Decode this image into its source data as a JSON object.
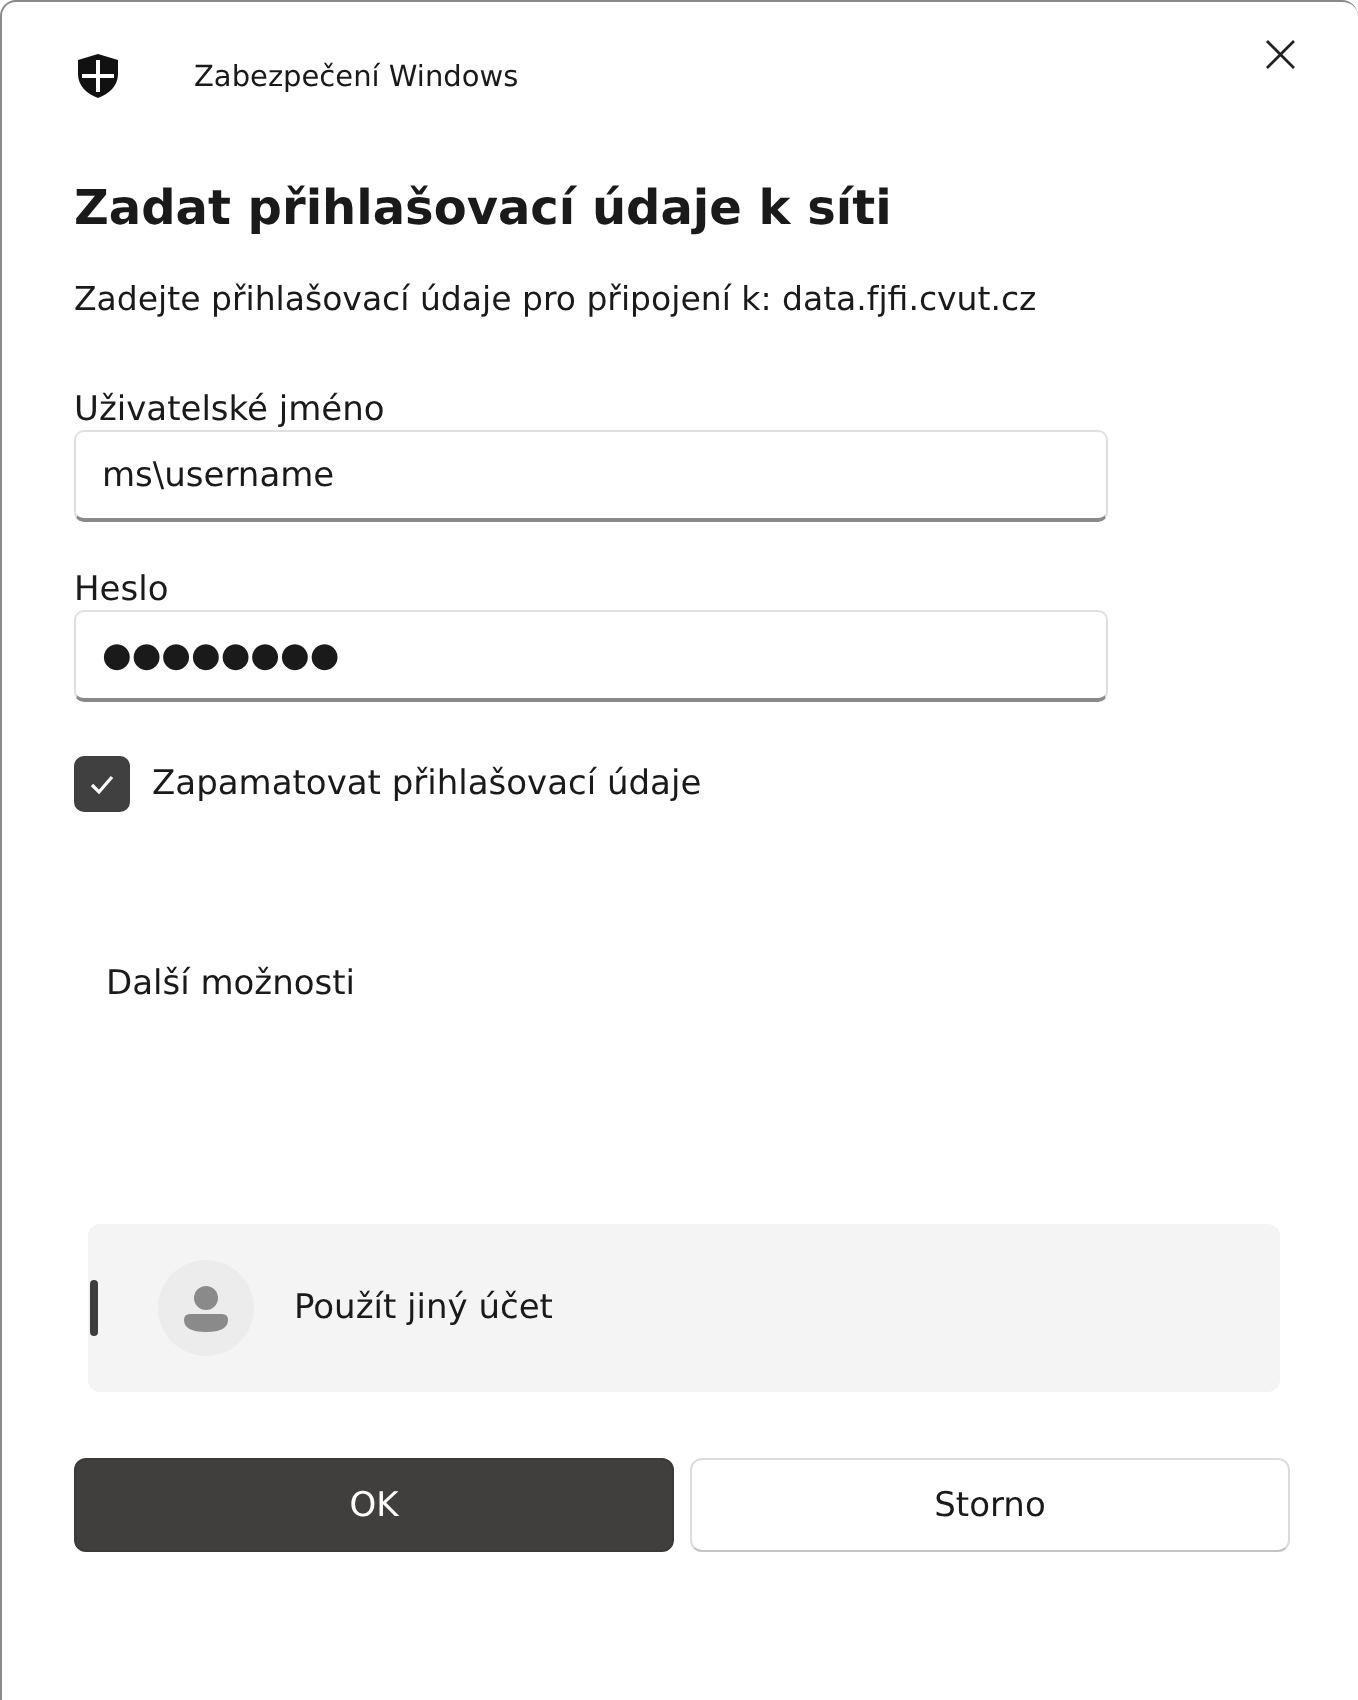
{
  "window": {
    "title": "Zabezpečení Windows",
    "close": "×"
  },
  "heading": "Zadat přihlašovací údaje k síti",
  "subtitle": "Zadejte přihlašovací údaje pro připojení k: data.fjfi.cvut.cz",
  "fields": [
    {
      "label": "Uživatelské jméno",
      "value": "ms\\username"
    },
    {
      "label": "Heslo",
      "value": "●●●●●●●●"
    }
  ],
  "remember": {
    "label": "Zapamatovat přihlašovací údaje",
    "checked": true
  },
  "more_options": "Další možnosti",
  "accounts": [
    {
      "label": "Použít jiný účet",
      "selected": true
    }
  ],
  "buttons": [
    {
      "label": "OK",
      "kind": "primary"
    },
    {
      "label": "Storno",
      "kind": "secondary"
    }
  ]
}
